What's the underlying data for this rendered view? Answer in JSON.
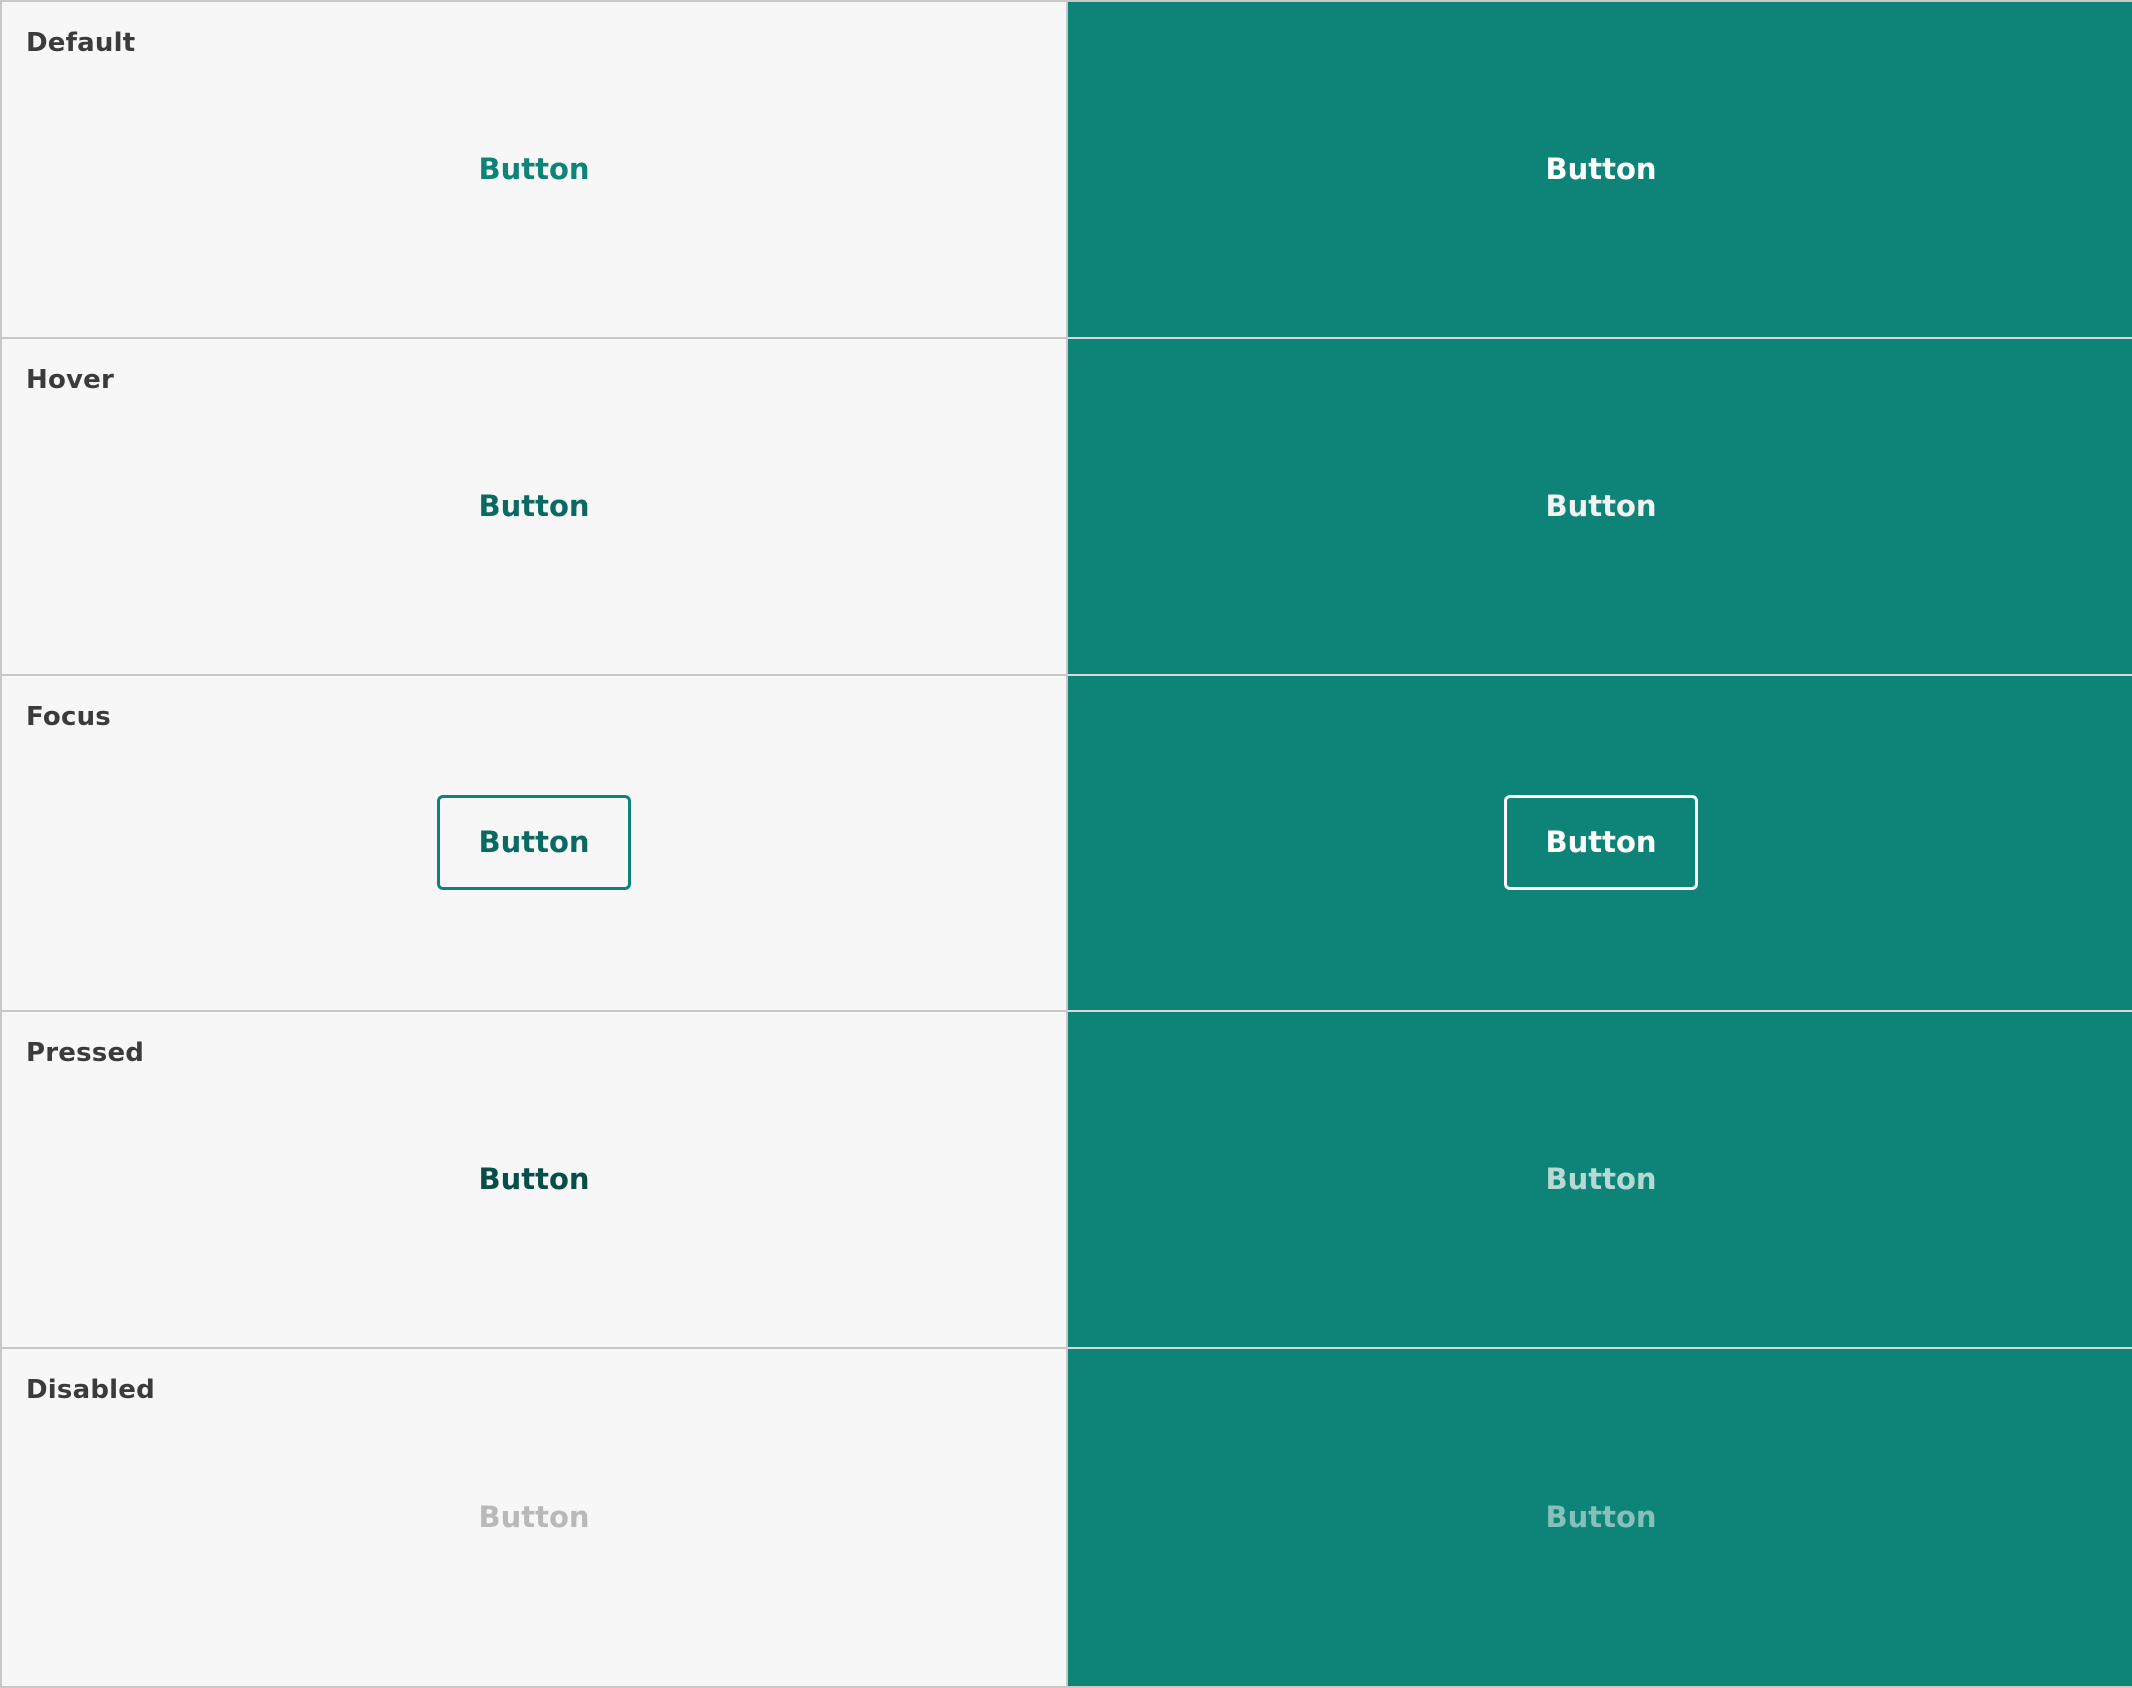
{
  "colors": {
    "light_background": "#f7f7f7",
    "dark_background": "#0e8378",
    "label_text": "#3b3b3b",
    "divider": "#c8c8c8"
  },
  "states": [
    {
      "label": "Default",
      "light": {
        "text": "Button",
        "color": "#0e8378",
        "border": "transparent"
      },
      "dark": {
        "text": "Button",
        "color": "#ffffff",
        "border": "transparent"
      }
    },
    {
      "label": "Hover",
      "light": {
        "text": "Button",
        "color": "#0a6a61",
        "border": "transparent"
      },
      "dark": {
        "text": "Button",
        "color": "#f2f2f2",
        "border": "transparent"
      }
    },
    {
      "label": "Focus",
      "light": {
        "text": "Button",
        "color": "#0a6a61",
        "border": "#0e8378"
      },
      "dark": {
        "text": "Button",
        "color": "#ffffff",
        "border": "#ffffff"
      }
    },
    {
      "label": "Pressed",
      "light": {
        "text": "Button",
        "color": "#064f48",
        "border": "transparent"
      },
      "dark": {
        "text": "Button",
        "color": "#b7d9d5",
        "border": "transparent"
      }
    },
    {
      "label": "Disabled",
      "light": {
        "text": "Button",
        "color": "#b9b9b9",
        "border": "transparent"
      },
      "dark": {
        "text": "Button",
        "color": "#86c0ba",
        "border": "transparent"
      }
    }
  ]
}
